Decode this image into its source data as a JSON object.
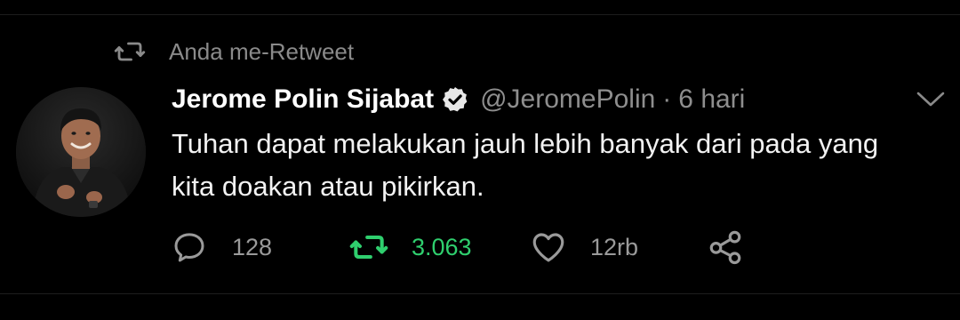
{
  "retweet_context": {
    "icon": "retweet-icon",
    "label": "Anda me-Retweet"
  },
  "tweet": {
    "author": {
      "display_name": "Jerome Polin Sijabat",
      "verified": true,
      "handle": "@JeromePolin",
      "separator": "·",
      "time": "6 hari",
      "avatar": "avatar-photo"
    },
    "text_line1": "Tuhan dapat melakukan jauh lebih banyak dari pada yang",
    "text_line2": "kita doakan atau pikirkan.",
    "menu_icon": "chevron-down-icon",
    "actions": {
      "reply": {
        "icon": "reply-icon",
        "count": "128"
      },
      "retweet": {
        "icon": "retweet-icon",
        "count": "3.063",
        "active": true,
        "color": "#2fcf6e"
      },
      "like": {
        "icon": "heart-icon",
        "count": "12rb"
      },
      "share": {
        "icon": "share-icon"
      }
    }
  },
  "colors": {
    "background": "#000000",
    "text_primary": "#ffffff",
    "text_secondary": "#8e8e8e",
    "retweet_active": "#2fcf6e",
    "divider": "#1d1d1d"
  }
}
